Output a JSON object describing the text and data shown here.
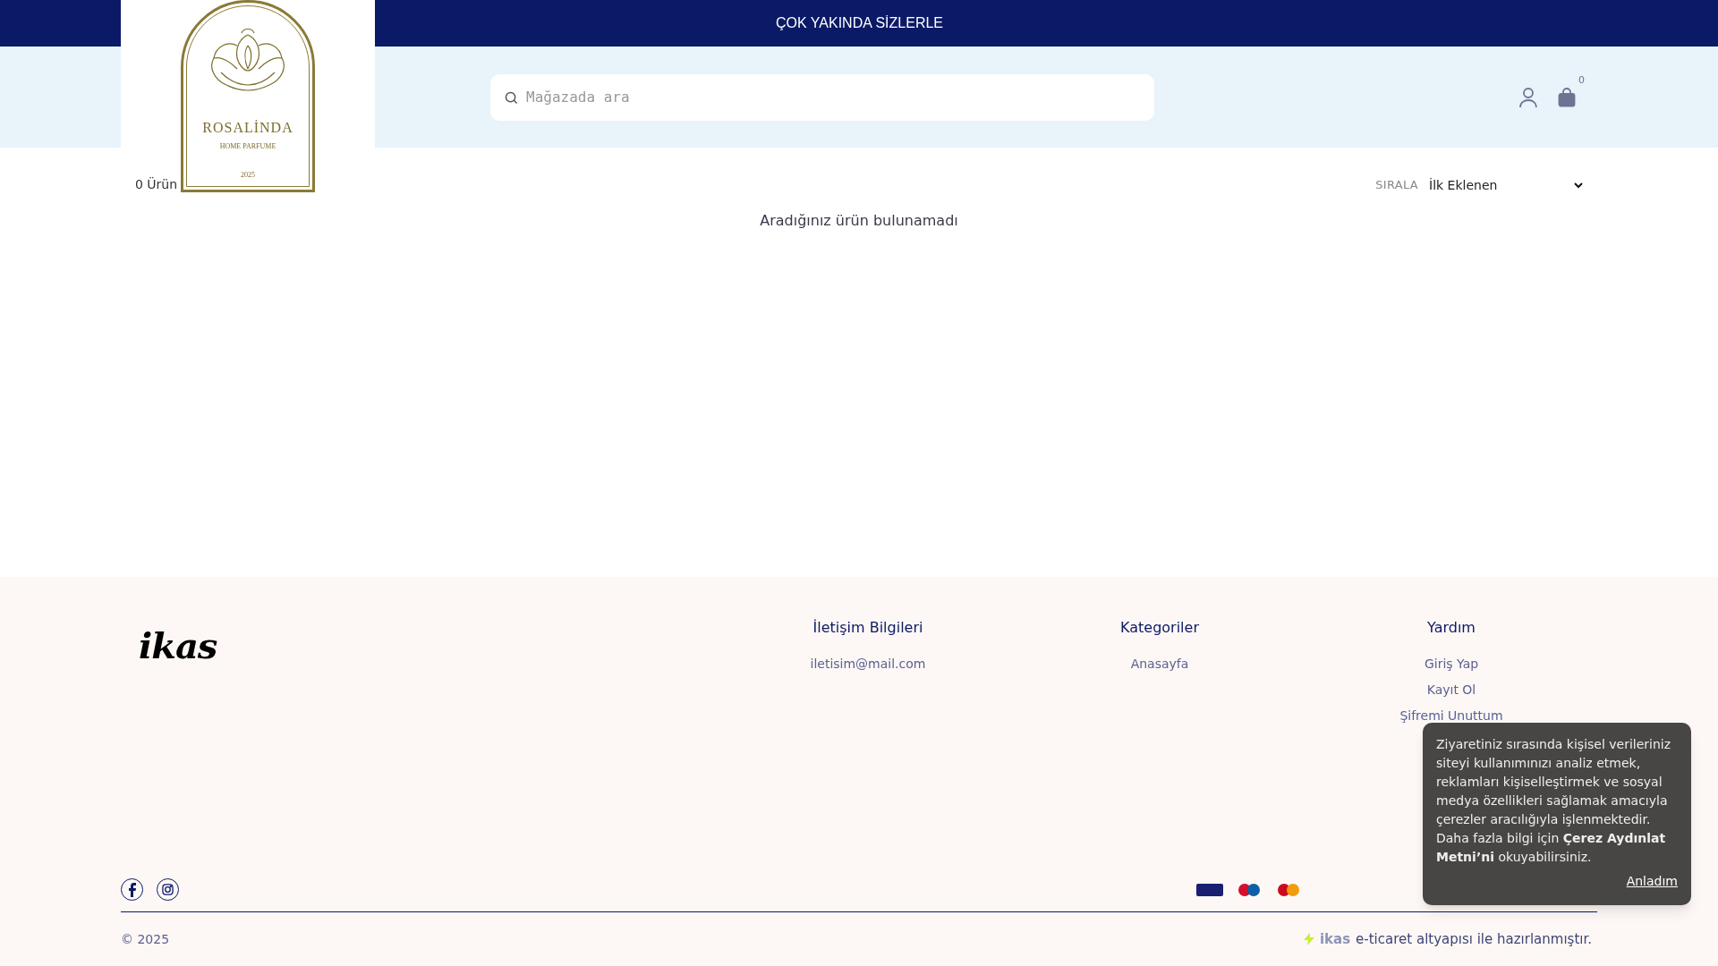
{
  "announcement": "ÇOK YAKINDA SİZLERLE",
  "logo": {
    "name": "ROSALİNDA",
    "tagline": "HOME PARFUME",
    "year": "2025"
  },
  "search": {
    "placeholder": "Mağazada ara"
  },
  "cart": {
    "count": "0"
  },
  "toolbar": {
    "count": "0 Ürün",
    "sort_label": "SIRALA",
    "sort_value": "İlk Eklenen"
  },
  "empty_message": "Aradığınız ürün bulunamadı",
  "footer": {
    "brand": "ikas",
    "columns": [
      {
        "title": "İletişim Bilgileri",
        "links": [
          "iletisim@mail.com"
        ]
      },
      {
        "title": "Kategoriler",
        "links": [
          "Anasayfa"
        ]
      },
      {
        "title": "Yardım",
        "links": [
          "Giriş Yap",
          "Kayıt Ol",
          "Şifremi Unuttum"
        ]
      }
    ],
    "social": [
      {
        "kind": "facebook"
      },
      {
        "kind": "instagram"
      }
    ],
    "copyright": "© 2025",
    "credit": {
      "brand": "ikas",
      "text": "e-ticaret altyapısı ile hazırlanmıştır."
    }
  },
  "cookie": {
    "text": "Ziyaretiniz sırasında kişisel verileriniz siteyi kullanımınızı analiz etmek, reklamları kişiselleştirmek ve sosyal medya özellikleri sağlamak amacıyla çerezler aracılığıyla işlenmektedir. Daha fazla bilgi için **Çerez Aydınlat Metni’ni** okuyabilirsiniz.",
    "button": "Anladım"
  }
}
